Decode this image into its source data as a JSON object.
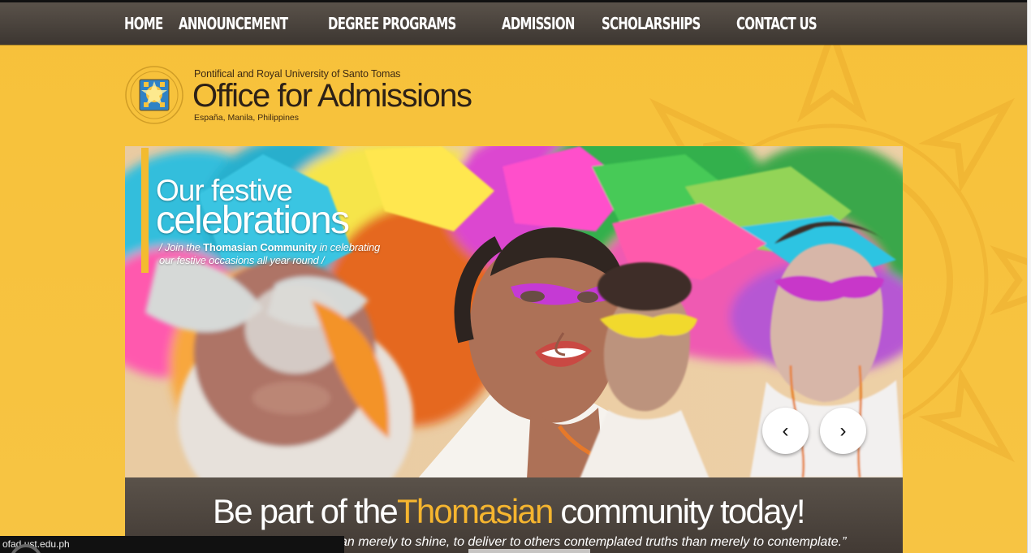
{
  "nav": {
    "items": [
      "HOME",
      "ANNOUNCEMENT",
      "DEGREE PROGRAMS",
      "ADMISSION",
      "SCHOLARSHIPS",
      "CONTACT US"
    ]
  },
  "brand": {
    "university": "Pontifical and Royal University of Santo Tomas",
    "office": "Office for Admissions",
    "address": "España, Manila, Philippines"
  },
  "hero": {
    "title_line1": "Our festive",
    "title_line2": "celebrations",
    "sub_prefix": "/ Join the ",
    "sub_strong": "Thomasian Community",
    "sub_suffix": " in celebrating",
    "sub_line2": "our festive occasions all year round /",
    "prev_icon": "chevron-left-icon",
    "next_icon": "chevron-right-icon"
  },
  "tagline": {
    "before": "Be part of the",
    "accent": "Thomasian",
    "after": " community today!"
  },
  "quote": {
    "text": "an merely to shine, to deliver to others contemplated truths than merely to contemplate.”"
  },
  "status": {
    "url": "ofad.ust.edu.ph"
  },
  "colors": {
    "page_bg": "#f7c33f",
    "nav_bg": "#463f39",
    "accent": "#f5b52f",
    "text_dark": "#2d2117"
  }
}
